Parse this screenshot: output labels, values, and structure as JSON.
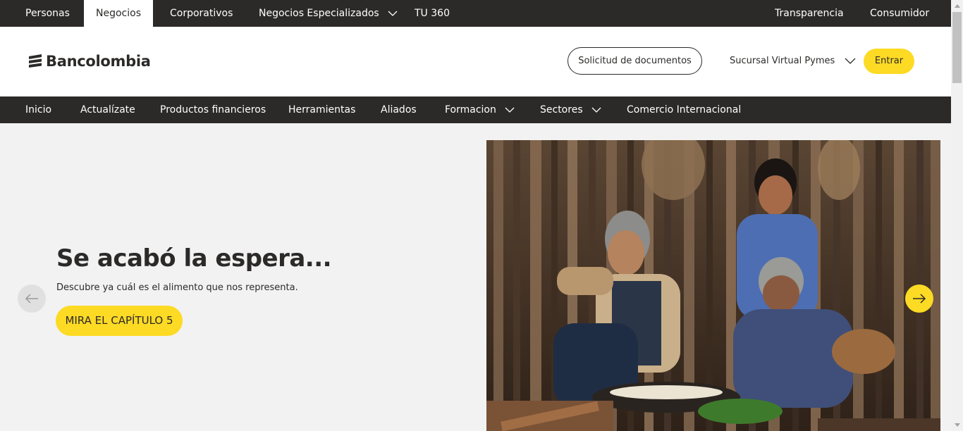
{
  "topbar": {
    "items": [
      {
        "label": "Personas"
      },
      {
        "label": "Negocios",
        "active": true
      },
      {
        "label": "Corporativos"
      },
      {
        "label": "Negocios Especializados",
        "has_dropdown": true
      },
      {
        "label": "TU 360"
      }
    ],
    "right_items": [
      {
        "label": "Transparencia"
      },
      {
        "label": "Consumidor"
      }
    ]
  },
  "header": {
    "logo_text": "Bancolombia",
    "docs_button": "Solicitud de documentos",
    "sucursal_label": "Sucursal Virtual Pymes",
    "login_button": "Entrar"
  },
  "navbar": {
    "items": [
      {
        "label": "Inicio"
      },
      {
        "label": "Actualízate"
      },
      {
        "label": "Productos financieros"
      },
      {
        "label": "Herramientas"
      },
      {
        "label": "Aliados"
      },
      {
        "label": "Formacion",
        "has_dropdown": true
      },
      {
        "label": "Sectores",
        "has_dropdown": true
      },
      {
        "label": "Comercio Internacional"
      }
    ]
  },
  "hero": {
    "title": "Se acabó la espera...",
    "subtitle": "Descubre ya cuál es el alimento que nos representa.",
    "cta": "MIRA EL CAPÍTULO 5"
  },
  "icons": {
    "prev": "arrow-left-icon",
    "next": "arrow-right-icon",
    "dropdown": "chevron-down-icon"
  },
  "colors": {
    "dark": "#2c2a29",
    "brand_yellow": "#fdda24",
    "hero_bg": "#f2f2f2"
  }
}
